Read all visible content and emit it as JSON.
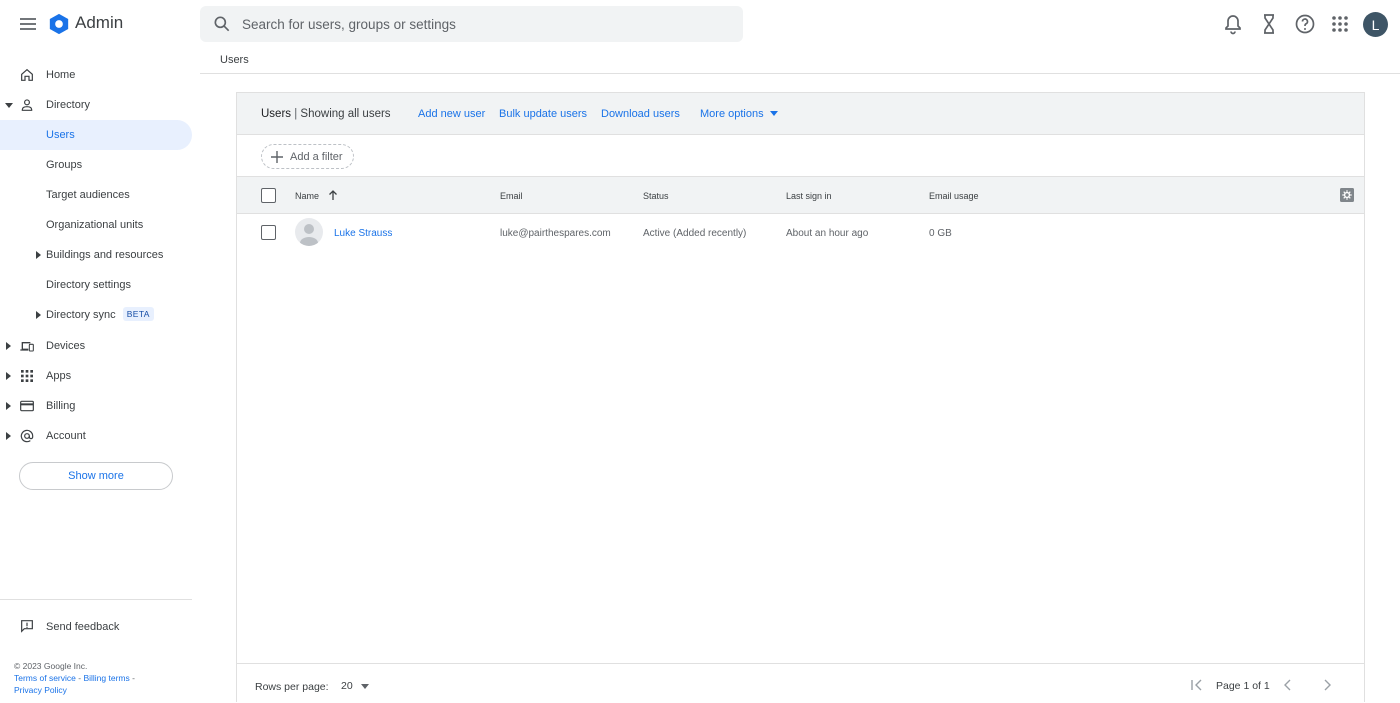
{
  "app": {
    "name": "Admin"
  },
  "search": {
    "placeholder": "Search for users, groups or settings"
  },
  "user": {
    "initial": "L"
  },
  "breadcrumb": "Users",
  "sidebar": {
    "items": [
      {
        "label": "Home"
      },
      {
        "label": "Directory"
      },
      {
        "label": "Users"
      },
      {
        "label": "Groups"
      },
      {
        "label": "Target audiences"
      },
      {
        "label": "Organizational units"
      },
      {
        "label": "Buildings and resources"
      },
      {
        "label": "Directory settings"
      },
      {
        "label": "Directory sync",
        "badge": "BETA"
      },
      {
        "label": "Devices"
      },
      {
        "label": "Apps"
      },
      {
        "label": "Billing"
      },
      {
        "label": "Account"
      }
    ],
    "show_more": "Show more",
    "feedback": "Send feedback"
  },
  "footer": {
    "copyright": "© 2023 Google Inc.",
    "terms": "Terms of service",
    "billing_terms": "Billing terms",
    "privacy": "Privacy Policy",
    "separator": " - "
  },
  "card": {
    "title_bold": "Users",
    "title_sep": " | ",
    "title_rest": "Showing all users",
    "actions": {
      "add": "Add new user",
      "bulk": "Bulk update users",
      "download": "Download users",
      "more": "More options"
    },
    "filter": "Add a filter"
  },
  "table": {
    "columns": {
      "name": "Name",
      "email": "Email",
      "status": "Status",
      "last_sign_in": "Last sign in",
      "email_usage": "Email usage"
    },
    "rows": [
      {
        "name": "Luke Strauss",
        "email": "luke@pairthespares.com",
        "status": "Active (Added recently)",
        "last_sign_in": "About an hour ago",
        "email_usage": "0 GB"
      }
    ]
  },
  "pagination": {
    "rows_per_page_label": "Rows per page:",
    "rows_per_page": "20",
    "page_label": "Page 1 of 1"
  },
  "colors": {
    "accent": "#1a73e8",
    "active_bg": "#e8f0fe",
    "header_bg": "#f1f3f4",
    "avatar_bg": "#3e5566"
  }
}
